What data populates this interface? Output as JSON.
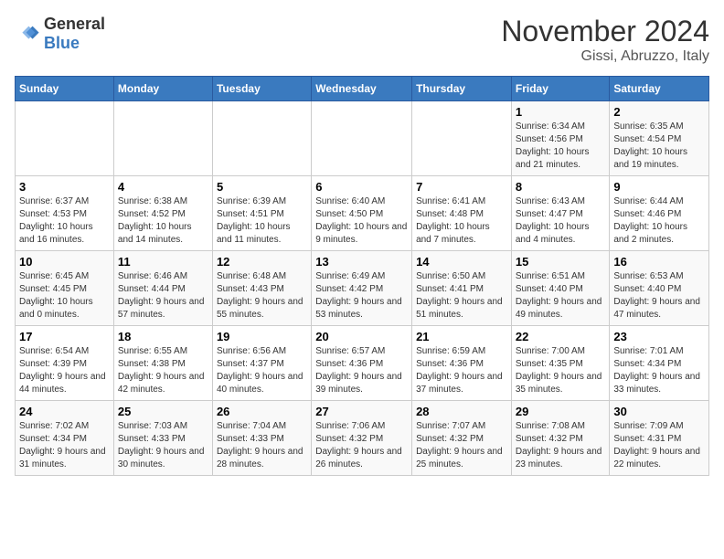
{
  "header": {
    "logo_general": "General",
    "logo_blue": "Blue",
    "month_title": "November 2024",
    "location": "Gissi, Abruzzo, Italy"
  },
  "days_of_week": [
    "Sunday",
    "Monday",
    "Tuesday",
    "Wednesday",
    "Thursday",
    "Friday",
    "Saturday"
  ],
  "weeks": [
    [
      {
        "day": "",
        "info": ""
      },
      {
        "day": "",
        "info": ""
      },
      {
        "day": "",
        "info": ""
      },
      {
        "day": "",
        "info": ""
      },
      {
        "day": "",
        "info": ""
      },
      {
        "day": "1",
        "info": "Sunrise: 6:34 AM\nSunset: 4:56 PM\nDaylight: 10 hours and 21 minutes."
      },
      {
        "day": "2",
        "info": "Sunrise: 6:35 AM\nSunset: 4:54 PM\nDaylight: 10 hours and 19 minutes."
      }
    ],
    [
      {
        "day": "3",
        "info": "Sunrise: 6:37 AM\nSunset: 4:53 PM\nDaylight: 10 hours and 16 minutes."
      },
      {
        "day": "4",
        "info": "Sunrise: 6:38 AM\nSunset: 4:52 PM\nDaylight: 10 hours and 14 minutes."
      },
      {
        "day": "5",
        "info": "Sunrise: 6:39 AM\nSunset: 4:51 PM\nDaylight: 10 hours and 11 minutes."
      },
      {
        "day": "6",
        "info": "Sunrise: 6:40 AM\nSunset: 4:50 PM\nDaylight: 10 hours and 9 minutes."
      },
      {
        "day": "7",
        "info": "Sunrise: 6:41 AM\nSunset: 4:48 PM\nDaylight: 10 hours and 7 minutes."
      },
      {
        "day": "8",
        "info": "Sunrise: 6:43 AM\nSunset: 4:47 PM\nDaylight: 10 hours and 4 minutes."
      },
      {
        "day": "9",
        "info": "Sunrise: 6:44 AM\nSunset: 4:46 PM\nDaylight: 10 hours and 2 minutes."
      }
    ],
    [
      {
        "day": "10",
        "info": "Sunrise: 6:45 AM\nSunset: 4:45 PM\nDaylight: 10 hours and 0 minutes."
      },
      {
        "day": "11",
        "info": "Sunrise: 6:46 AM\nSunset: 4:44 PM\nDaylight: 9 hours and 57 minutes."
      },
      {
        "day": "12",
        "info": "Sunrise: 6:48 AM\nSunset: 4:43 PM\nDaylight: 9 hours and 55 minutes."
      },
      {
        "day": "13",
        "info": "Sunrise: 6:49 AM\nSunset: 4:42 PM\nDaylight: 9 hours and 53 minutes."
      },
      {
        "day": "14",
        "info": "Sunrise: 6:50 AM\nSunset: 4:41 PM\nDaylight: 9 hours and 51 minutes."
      },
      {
        "day": "15",
        "info": "Sunrise: 6:51 AM\nSunset: 4:40 PM\nDaylight: 9 hours and 49 minutes."
      },
      {
        "day": "16",
        "info": "Sunrise: 6:53 AM\nSunset: 4:40 PM\nDaylight: 9 hours and 47 minutes."
      }
    ],
    [
      {
        "day": "17",
        "info": "Sunrise: 6:54 AM\nSunset: 4:39 PM\nDaylight: 9 hours and 44 minutes."
      },
      {
        "day": "18",
        "info": "Sunrise: 6:55 AM\nSunset: 4:38 PM\nDaylight: 9 hours and 42 minutes."
      },
      {
        "day": "19",
        "info": "Sunrise: 6:56 AM\nSunset: 4:37 PM\nDaylight: 9 hours and 40 minutes."
      },
      {
        "day": "20",
        "info": "Sunrise: 6:57 AM\nSunset: 4:36 PM\nDaylight: 9 hours and 39 minutes."
      },
      {
        "day": "21",
        "info": "Sunrise: 6:59 AM\nSunset: 4:36 PM\nDaylight: 9 hours and 37 minutes."
      },
      {
        "day": "22",
        "info": "Sunrise: 7:00 AM\nSunset: 4:35 PM\nDaylight: 9 hours and 35 minutes."
      },
      {
        "day": "23",
        "info": "Sunrise: 7:01 AM\nSunset: 4:34 PM\nDaylight: 9 hours and 33 minutes."
      }
    ],
    [
      {
        "day": "24",
        "info": "Sunrise: 7:02 AM\nSunset: 4:34 PM\nDaylight: 9 hours and 31 minutes."
      },
      {
        "day": "25",
        "info": "Sunrise: 7:03 AM\nSunset: 4:33 PM\nDaylight: 9 hours and 30 minutes."
      },
      {
        "day": "26",
        "info": "Sunrise: 7:04 AM\nSunset: 4:33 PM\nDaylight: 9 hours and 28 minutes."
      },
      {
        "day": "27",
        "info": "Sunrise: 7:06 AM\nSunset: 4:32 PM\nDaylight: 9 hours and 26 minutes."
      },
      {
        "day": "28",
        "info": "Sunrise: 7:07 AM\nSunset: 4:32 PM\nDaylight: 9 hours and 25 minutes."
      },
      {
        "day": "29",
        "info": "Sunrise: 7:08 AM\nSunset: 4:32 PM\nDaylight: 9 hours and 23 minutes."
      },
      {
        "day": "30",
        "info": "Sunrise: 7:09 AM\nSunset: 4:31 PM\nDaylight: 9 hours and 22 minutes."
      }
    ]
  ]
}
